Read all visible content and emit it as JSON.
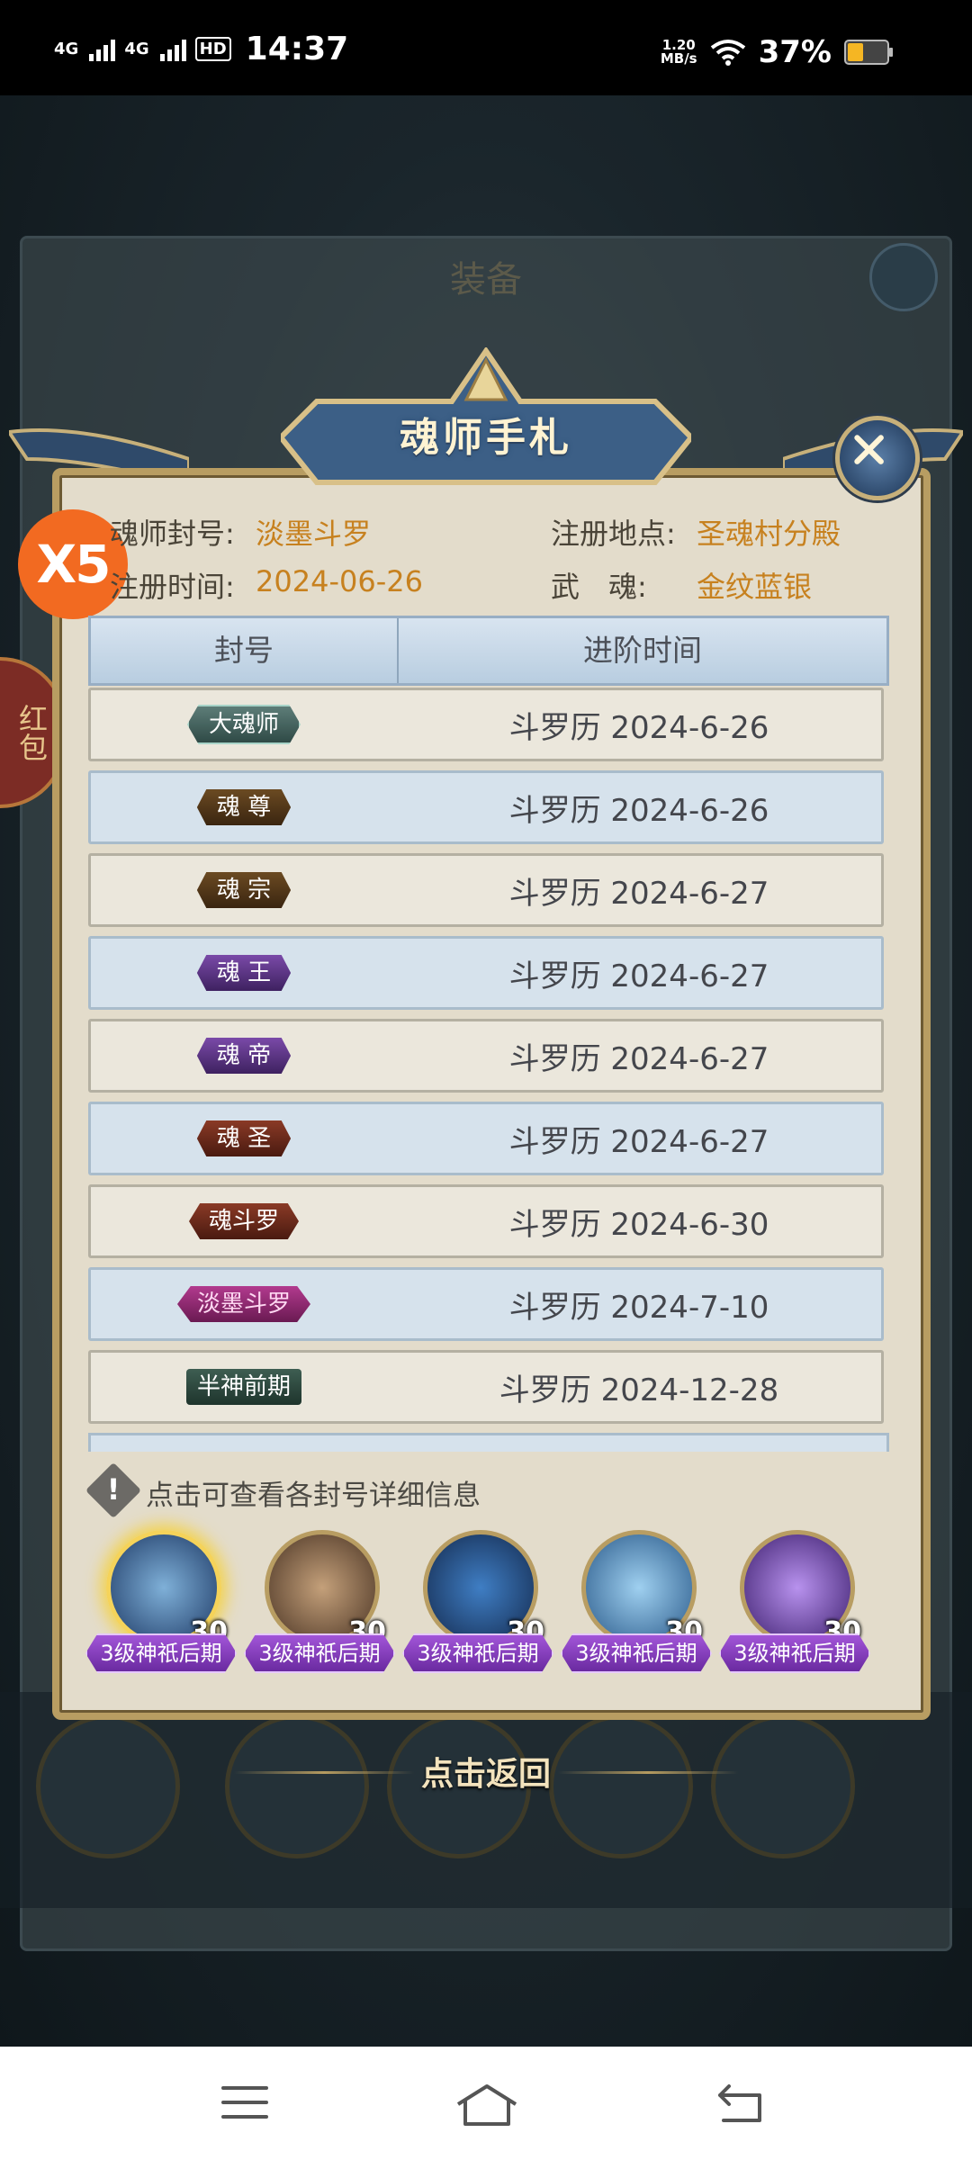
{
  "status_bar": {
    "signal1": "4G",
    "signal2": "4G",
    "hd": "HD",
    "time": "14:37",
    "speed_value": "1.20",
    "speed_unit": "MB/s",
    "battery": "37%"
  },
  "background": {
    "panel_title": "装备",
    "red_packet": "红包"
  },
  "overlay_badge": "X5",
  "dialog": {
    "title": "魂师手札",
    "info": {
      "title_label": "魂师封号:",
      "title_value": "淡墨斗罗",
      "location_label": "注册地点:",
      "location_value": "圣魂村分殿",
      "time_label": "注册时间:",
      "time_value": "2024-06-26",
      "soul_label": "武　魂:",
      "soul_value": "金纹蓝银"
    },
    "table": {
      "col_title": "封号",
      "col_time": "进阶时间",
      "rows": [
        {
          "badge": "大魂师",
          "date": "斗罗历 2024-6-26"
        },
        {
          "badge": "魂 尊",
          "date": "斗罗历 2024-6-26"
        },
        {
          "badge": "魂 宗",
          "date": "斗罗历 2024-6-27"
        },
        {
          "badge": "魂 王",
          "date": "斗罗历 2024-6-27"
        },
        {
          "badge": "魂 帝",
          "date": "斗罗历 2024-6-27"
        },
        {
          "badge": "魂 圣",
          "date": "斗罗历 2024-6-27"
        },
        {
          "badge": "魂斗罗",
          "date": "斗罗历 2024-6-30"
        },
        {
          "badge": "淡墨斗罗",
          "date": "斗罗历 2024-7-10"
        },
        {
          "badge": "半神前期",
          "date": "斗罗历 2024-12-28"
        }
      ]
    },
    "hint": "点击可查看各封号详细信息",
    "avatars": [
      {
        "level": "30",
        "tag": "3级神祇后期"
      },
      {
        "level": "30",
        "tag": "3级神祇后期"
      },
      {
        "level": "30",
        "tag": "3级神祇后期"
      },
      {
        "level": "30",
        "tag": "3级神祇后期"
      },
      {
        "level": "30",
        "tag": "3级神祇后期"
      }
    ]
  },
  "back_label": "点击返回"
}
